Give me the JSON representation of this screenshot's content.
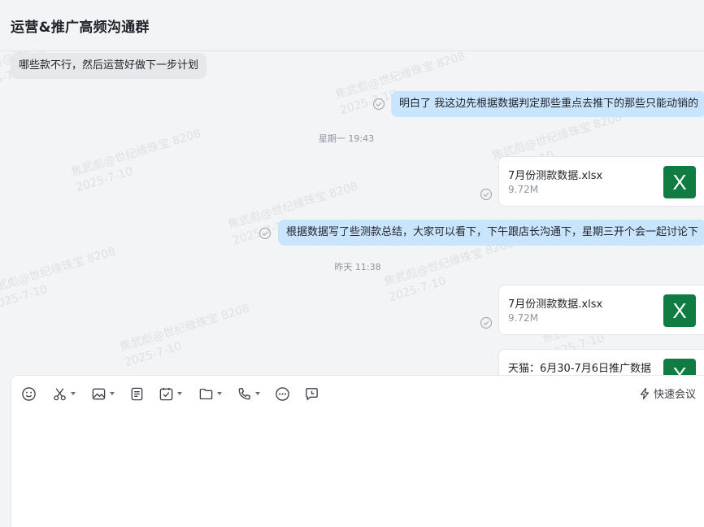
{
  "chat": {
    "title": "运营&推广高频沟通群"
  },
  "watermark": {
    "line1": "焦武彪@世纪缘珠宝 8208",
    "line2": "2025-7-10"
  },
  "messages": {
    "m1": {
      "text": "哪些款不行，然后运营好做下一步计划"
    },
    "m2": {
      "text": "明白了 我这边先根据数据判定那些重点去推下的那些只能动销的"
    },
    "time1": "星期一 19:43",
    "file1": {
      "name": "7月份测款数据.xlsx",
      "size": "9.72M",
      "icon": "X"
    },
    "m3": {
      "text": "根据数据写了些测款总结，大家可以看下，下午跟店长沟通下，星期三开个会一起讨论下"
    },
    "time2": "昨天 11:38",
    "file2": {
      "name": "7月份测款数据.xlsx",
      "size": "9.72M",
      "icon": "X"
    },
    "file3": {
      "name": "天猫：6月30-7月6日推广数据",
      "icon": "X"
    }
  },
  "toolbar": {
    "icons": [
      "emoji-icon",
      "scissors-icon",
      "image-icon",
      "document-icon",
      "task-icon",
      "folder-icon",
      "phone-icon",
      "more-icon",
      "message-icon"
    ],
    "quick_meeting": "快速会议"
  },
  "colors": {
    "outgoing_bubble": "#c9e4fd",
    "incoming_bubble": "#e6e8eb",
    "excel_green": "#107c41"
  }
}
